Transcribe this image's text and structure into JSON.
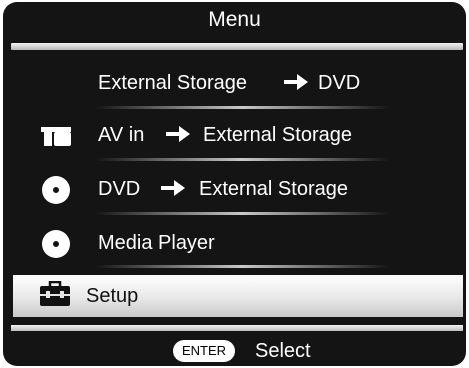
{
  "menu": {
    "title": "Menu",
    "items": [
      {
        "icon": "",
        "label_a": "External Storage",
        "arrow": true,
        "label_b": "DVD"
      },
      {
        "icon": "av-in-icon",
        "label_a": "AV in",
        "arrow": true,
        "label_b": "External Storage"
      },
      {
        "icon": "disc-icon",
        "label_a": "DVD",
        "arrow": true,
        "label_b": "External Storage"
      },
      {
        "icon": "disc-icon",
        "label_a": "Media Player",
        "arrow": false
      },
      {
        "icon": "toolbox-icon",
        "label_a": "Setup",
        "arrow": false,
        "selected": true
      }
    ]
  },
  "footer": {
    "key_label": "ENTER",
    "action_label": "Select"
  }
}
